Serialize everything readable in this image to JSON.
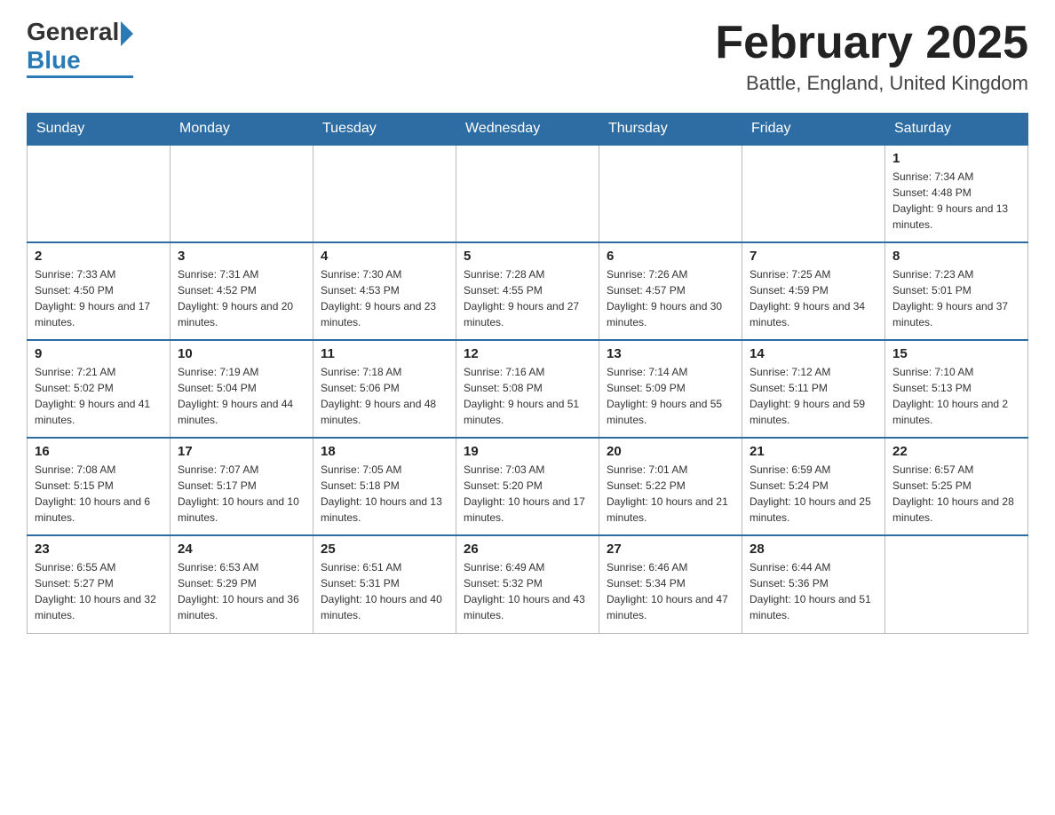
{
  "header": {
    "logo": {
      "general": "General",
      "blue": "Blue"
    },
    "title": "February 2025",
    "location": "Battle, England, United Kingdom"
  },
  "calendar": {
    "days_of_week": [
      "Sunday",
      "Monday",
      "Tuesday",
      "Wednesday",
      "Thursday",
      "Friday",
      "Saturday"
    ],
    "weeks": [
      [
        {
          "day": "",
          "info": ""
        },
        {
          "day": "",
          "info": ""
        },
        {
          "day": "",
          "info": ""
        },
        {
          "day": "",
          "info": ""
        },
        {
          "day": "",
          "info": ""
        },
        {
          "day": "",
          "info": ""
        },
        {
          "day": "1",
          "info": "Sunrise: 7:34 AM\nSunset: 4:48 PM\nDaylight: 9 hours and 13 minutes."
        }
      ],
      [
        {
          "day": "2",
          "info": "Sunrise: 7:33 AM\nSunset: 4:50 PM\nDaylight: 9 hours and 17 minutes."
        },
        {
          "day": "3",
          "info": "Sunrise: 7:31 AM\nSunset: 4:52 PM\nDaylight: 9 hours and 20 minutes."
        },
        {
          "day": "4",
          "info": "Sunrise: 7:30 AM\nSunset: 4:53 PM\nDaylight: 9 hours and 23 minutes."
        },
        {
          "day": "5",
          "info": "Sunrise: 7:28 AM\nSunset: 4:55 PM\nDaylight: 9 hours and 27 minutes."
        },
        {
          "day": "6",
          "info": "Sunrise: 7:26 AM\nSunset: 4:57 PM\nDaylight: 9 hours and 30 minutes."
        },
        {
          "day": "7",
          "info": "Sunrise: 7:25 AM\nSunset: 4:59 PM\nDaylight: 9 hours and 34 minutes."
        },
        {
          "day": "8",
          "info": "Sunrise: 7:23 AM\nSunset: 5:01 PM\nDaylight: 9 hours and 37 minutes."
        }
      ],
      [
        {
          "day": "9",
          "info": "Sunrise: 7:21 AM\nSunset: 5:02 PM\nDaylight: 9 hours and 41 minutes."
        },
        {
          "day": "10",
          "info": "Sunrise: 7:19 AM\nSunset: 5:04 PM\nDaylight: 9 hours and 44 minutes."
        },
        {
          "day": "11",
          "info": "Sunrise: 7:18 AM\nSunset: 5:06 PM\nDaylight: 9 hours and 48 minutes."
        },
        {
          "day": "12",
          "info": "Sunrise: 7:16 AM\nSunset: 5:08 PM\nDaylight: 9 hours and 51 minutes."
        },
        {
          "day": "13",
          "info": "Sunrise: 7:14 AM\nSunset: 5:09 PM\nDaylight: 9 hours and 55 minutes."
        },
        {
          "day": "14",
          "info": "Sunrise: 7:12 AM\nSunset: 5:11 PM\nDaylight: 9 hours and 59 minutes."
        },
        {
          "day": "15",
          "info": "Sunrise: 7:10 AM\nSunset: 5:13 PM\nDaylight: 10 hours and 2 minutes."
        }
      ],
      [
        {
          "day": "16",
          "info": "Sunrise: 7:08 AM\nSunset: 5:15 PM\nDaylight: 10 hours and 6 minutes."
        },
        {
          "day": "17",
          "info": "Sunrise: 7:07 AM\nSunset: 5:17 PM\nDaylight: 10 hours and 10 minutes."
        },
        {
          "day": "18",
          "info": "Sunrise: 7:05 AM\nSunset: 5:18 PM\nDaylight: 10 hours and 13 minutes."
        },
        {
          "day": "19",
          "info": "Sunrise: 7:03 AM\nSunset: 5:20 PM\nDaylight: 10 hours and 17 minutes."
        },
        {
          "day": "20",
          "info": "Sunrise: 7:01 AM\nSunset: 5:22 PM\nDaylight: 10 hours and 21 minutes."
        },
        {
          "day": "21",
          "info": "Sunrise: 6:59 AM\nSunset: 5:24 PM\nDaylight: 10 hours and 25 minutes."
        },
        {
          "day": "22",
          "info": "Sunrise: 6:57 AM\nSunset: 5:25 PM\nDaylight: 10 hours and 28 minutes."
        }
      ],
      [
        {
          "day": "23",
          "info": "Sunrise: 6:55 AM\nSunset: 5:27 PM\nDaylight: 10 hours and 32 minutes."
        },
        {
          "day": "24",
          "info": "Sunrise: 6:53 AM\nSunset: 5:29 PM\nDaylight: 10 hours and 36 minutes."
        },
        {
          "day": "25",
          "info": "Sunrise: 6:51 AM\nSunset: 5:31 PM\nDaylight: 10 hours and 40 minutes."
        },
        {
          "day": "26",
          "info": "Sunrise: 6:49 AM\nSunset: 5:32 PM\nDaylight: 10 hours and 43 minutes."
        },
        {
          "day": "27",
          "info": "Sunrise: 6:46 AM\nSunset: 5:34 PM\nDaylight: 10 hours and 47 minutes."
        },
        {
          "day": "28",
          "info": "Sunrise: 6:44 AM\nSunset: 5:36 PM\nDaylight: 10 hours and 51 minutes."
        },
        {
          "day": "",
          "info": ""
        }
      ]
    ]
  }
}
